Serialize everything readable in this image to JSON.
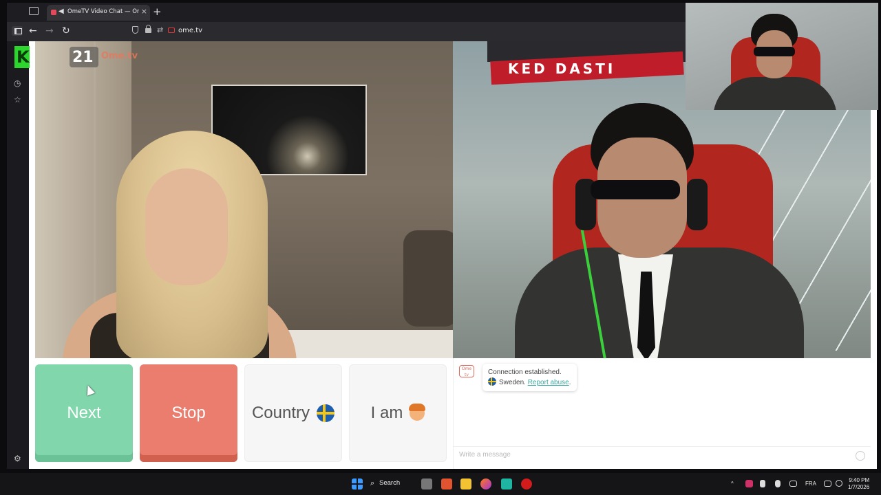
{
  "browser": {
    "tab_title": "OmeTV Video Chat — Ome",
    "tab_audio_icon": "speaker-icon",
    "tab_close": "×",
    "new_tab": "+",
    "back": "←",
    "forward": "→",
    "reload": "↻",
    "perm_icon": "⇄",
    "url": "ome.tv"
  },
  "sidebar": {
    "history_icon": "◷",
    "bookmarks_icon": "☆",
    "settings_icon": "⚙"
  },
  "overlay": {
    "logo_number": "21",
    "logo_text": "Ome.tv"
  },
  "remote_video": {
    "scarf_text": "KED DASTI"
  },
  "controls": {
    "next_label": "Next",
    "stop_label": "Stop",
    "country_label": "Country",
    "iam_label": "I am"
  },
  "chat": {
    "logo_text": "Ome tv",
    "status_line": "Connection established.",
    "country_line": "Sweden.",
    "report_link": "Report abuse",
    "report_suffix": ".",
    "input_placeholder": "Write a message"
  },
  "taskbar": {
    "search_label": "Search",
    "language": "FRA",
    "time": "9:40 PM",
    "date": "1/7/2026"
  }
}
